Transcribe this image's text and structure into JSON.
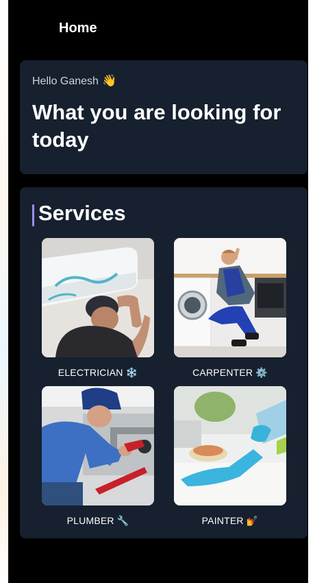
{
  "app_bar": {
    "title": "Home"
  },
  "greeting": {
    "hello": "Hello Ganesh",
    "hello_emoji": "👋",
    "headline": "What you are looking for today"
  },
  "services": {
    "title": "Services",
    "accent_color": "#9d8cf7",
    "items": [
      {
        "label": "ELECTRICIAN",
        "emoji": "❄️",
        "photo_icon": "ac-repair-photo"
      },
      {
        "label": "CARPENTER",
        "emoji": "⚙️",
        "photo_icon": "washing-machine-photo"
      },
      {
        "label": "PLUMBER",
        "emoji": "🔧",
        "photo_icon": "plumber-photo"
      },
      {
        "label": "PAINTER",
        "emoji": "💅",
        "photo_icon": "cleaning-photo"
      }
    ]
  },
  "colors": {
    "background": "#000000",
    "card": "#16202e",
    "text": "#ffffff"
  }
}
